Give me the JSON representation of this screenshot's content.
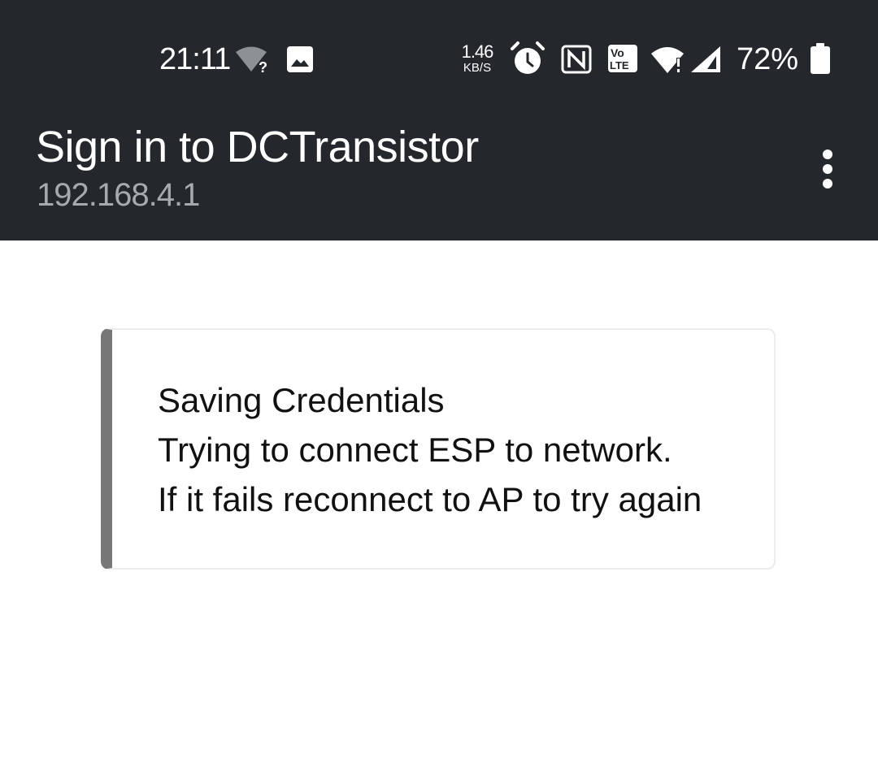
{
  "status_bar": {
    "time": "21:11",
    "net_speed_value": "1.46",
    "net_speed_unit": "KB/S",
    "battery_percent": "72%",
    "icons": [
      "wifi-question-icon",
      "image-icon",
      "alarm-icon",
      "nfc-icon",
      "volte-icon",
      "wifi-alert-icon",
      "cell-signal-icon",
      "battery-icon"
    ]
  },
  "app_bar": {
    "title": "Sign in to DCTransistor",
    "subtitle": "192.168.4.1",
    "menu_icon": "overflow-menu-icon"
  },
  "message_card": {
    "lines": [
      "Saving Credentials",
      "Trying to connect ESP to network.",
      "If it fails reconnect to AP to try again"
    ]
  },
  "colors": {
    "toolbar_bg": "#24282c",
    "card_accent": "#777777",
    "card_border": "#ececec"
  }
}
